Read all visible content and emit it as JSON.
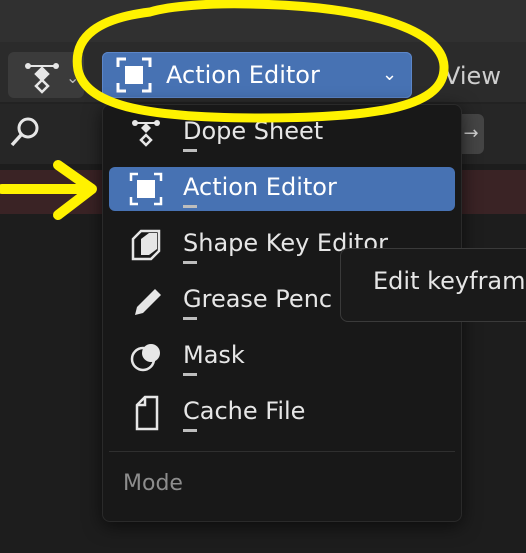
{
  "header": {
    "editor_type": {
      "icon": "dope-sheet-icon",
      "chevron": "⌄"
    },
    "mode_dropdown": {
      "label": "Action Editor",
      "icon": "action-editor-icon",
      "chevron": "⌄",
      "selected": true
    },
    "view_menu_label": "View"
  },
  "toolbar": {
    "search_icon": "search-icon",
    "right_arrow": "→"
  },
  "dropdown_menu": {
    "items": [
      {
        "label": "Dope Sheet",
        "icon": "dope-sheet-icon",
        "active": false
      },
      {
        "label": "Action Editor",
        "icon": "action-editor-icon",
        "active": true
      },
      {
        "label": "Shape Key Editor",
        "icon": "shape-key-editor-icon",
        "active": false
      },
      {
        "label": "Grease Penc",
        "icon": "grease-pencil-icon",
        "active": false
      },
      {
        "label": "Mask",
        "icon": "mask-icon",
        "active": false
      },
      {
        "label": "Cache File",
        "icon": "cache-file-icon",
        "active": false
      }
    ],
    "section_label": "Mode"
  },
  "tooltip": {
    "text": "Edit keyfram"
  },
  "annotations": {
    "highlight_color": "#fff200",
    "highlight_shape": "circle",
    "arrow": "right-arrow-annotation"
  },
  "colors": {
    "accent": "#4772b3",
    "background": "#1d1d1d",
    "menu_bg": "#181818",
    "channel_strip": "#3a2325"
  }
}
